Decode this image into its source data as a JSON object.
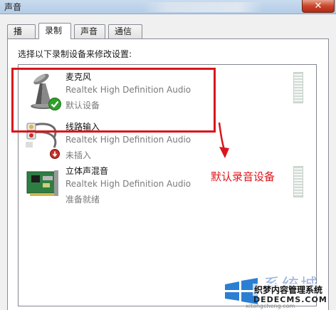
{
  "window": {
    "title": "声音",
    "close_glyph": "✕"
  },
  "tabs": [
    {
      "label": "播放",
      "active": false
    },
    {
      "label": "录制",
      "active": true
    },
    {
      "label": "声音",
      "active": false
    },
    {
      "label": "通信",
      "active": false
    }
  ],
  "panel": {
    "instruction": "选择以下录制设备来修改设置:"
  },
  "devices": [
    {
      "name": "麦克风",
      "description": "Realtek High Definition Audio",
      "status": "默认设备",
      "icon": "microphone-icon",
      "default": true
    },
    {
      "name": "线路输入",
      "description": "Realtek High Definition Audio",
      "status": "未插入",
      "icon": "audio-jack-icon",
      "default": false
    },
    {
      "name": "立体声混音",
      "description": "Realtek High Definition Audio",
      "status": "准备就绪",
      "icon": "sound-card-icon",
      "default": false
    }
  ],
  "annotation": {
    "text": "默认录音设备",
    "color": "#e0141a"
  },
  "watermark": {
    "brand_big": "系统城",
    "site_name": "织梦内容管理系统",
    "domain": "DEDECMS.COM",
    "small": "xitongcheng.com"
  },
  "colors": {
    "highlight": "#d8161b",
    "accent_check": "#2fa12a"
  }
}
